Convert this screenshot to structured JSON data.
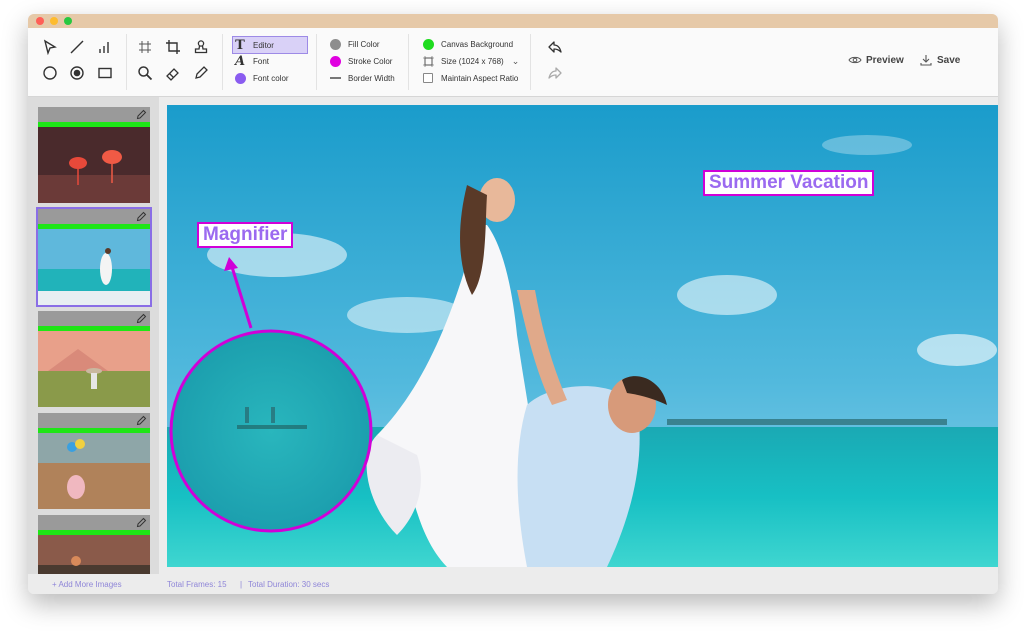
{
  "toolbar": {
    "editor_label": "Editor",
    "font_label": "Font",
    "font_color_label": "Font color",
    "fill_color_label": "Fill Color",
    "stroke_color_label": "Stroke Color",
    "border_width_label": "Border Width",
    "canvas_background_label": "Canvas Background",
    "size_label": "Size (1024 x 768)",
    "maintain_aspect_label": "Maintain Aspect Ratio",
    "preview_label": "Preview",
    "save_label": "Save"
  },
  "colors": {
    "fill": "#8e8e8e",
    "stroke": "#e000e0",
    "font": "#8a5cf0",
    "canvas_background": "#1fdc1f",
    "annotation": "#d000d8",
    "annotation_text": "#9b6af0"
  },
  "sidebar": {
    "add_more_label": "+ Add More Images",
    "thumbnails": [
      {
        "scene": "flamingos"
      },
      {
        "scene": "beach couple",
        "selected": true
      },
      {
        "scene": "sunset field"
      },
      {
        "scene": "girl with balloons"
      },
      {
        "scene": "sunset road"
      }
    ]
  },
  "canvas": {
    "summer_label": "Summer Vacation",
    "magnifier_label": "Magnifier"
  },
  "status": {
    "frames": "Total Frames: 15",
    "separator": "|",
    "duration": "Total Duration: 30 secs"
  }
}
